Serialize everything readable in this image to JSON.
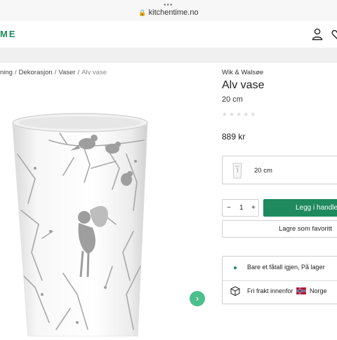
{
  "browser": {
    "dots": "•••",
    "url": "kitchentime.no"
  },
  "header": {
    "logo": "ME"
  },
  "breadcrumb": {
    "items": [
      "ning",
      "Dekorasjon",
      "Vaser"
    ],
    "current": "Alv vase"
  },
  "product": {
    "brand": "Wik & Walsøe",
    "title": "Alv vase",
    "size": "20 cm",
    "rating_stars": "★★★★★",
    "price": "889 kr",
    "variant_label": "20 cm"
  },
  "purchase": {
    "qty_minus": "−",
    "qty_value": "1",
    "qty_plus": "+",
    "add_to_cart": "Legg i handlekurv",
    "save_favorite": "Lagre som favoritt"
  },
  "info": {
    "stock": "Bare et fåtall igjen, På lager",
    "shipping": "Fri frakt innenfor",
    "country": "Norge"
  },
  "colors": {
    "accent": "#1e8a5e",
    "arrow": "#4cbf8e"
  }
}
